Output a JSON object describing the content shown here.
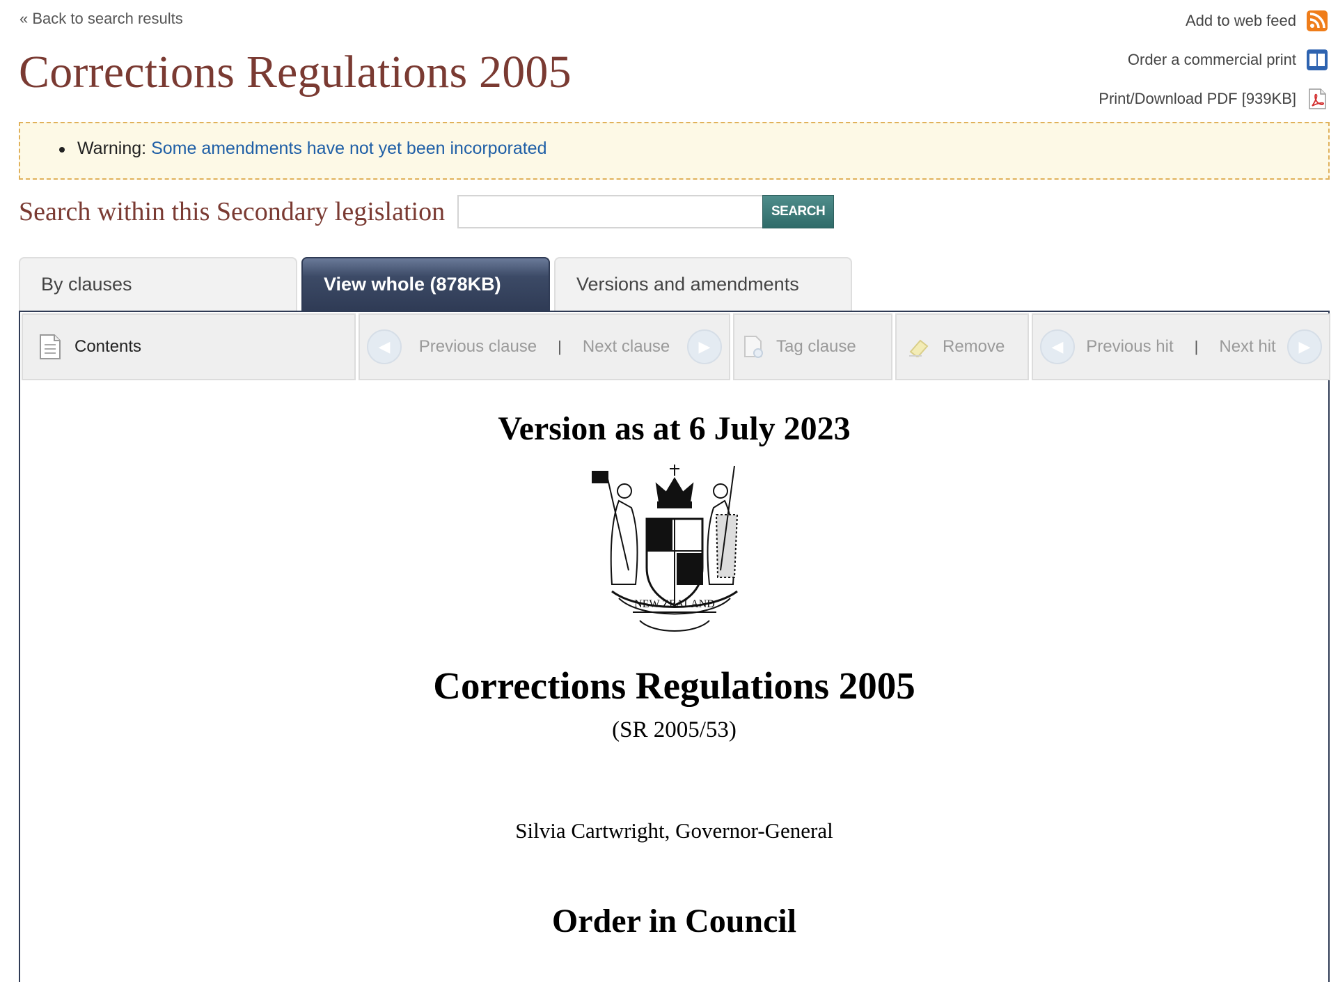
{
  "nav": {
    "back_link": "« Back to search results"
  },
  "header": {
    "title": "Corrections Regulations 2005"
  },
  "actions": {
    "web_feed": "Add to web feed",
    "commercial_print": "Order a commercial print",
    "pdf": "Print/Download PDF [939KB]"
  },
  "warning": {
    "label": "Warning:",
    "link_text": "Some amendments have not yet been incorporated"
  },
  "search": {
    "label": "Search within this Secondary legislation",
    "placeholder": "",
    "button": "SEARCH"
  },
  "tabs": [
    {
      "label": "By clauses"
    },
    {
      "label": "View whole (878KB)"
    },
    {
      "label": "Versions and amendments"
    }
  ],
  "toolbar": {
    "contents": "Contents",
    "previous_clause": "Previous clause",
    "next_clause": "Next clause",
    "tag_clause": "Tag clause",
    "remove": "Remove",
    "previous_hit": "Previous hit",
    "next_hit": "Next hit",
    "separator": "|"
  },
  "document": {
    "version": "Version as at 6 July 2023",
    "crest_text": "NEW ZEALAND",
    "title": "Corrections Regulations 2005",
    "reference": "(SR 2005/53)",
    "governor": "Silvia Cartwright, Governor-General",
    "order_heading": "Order in Council"
  },
  "colors": {
    "title": "#7a3a32",
    "link": "#1f5fa6",
    "active_tab": "#2f3b55",
    "search_button": "#3a7775",
    "warning_bg": "#fdf9e6",
    "warning_border": "#e0b15a"
  }
}
